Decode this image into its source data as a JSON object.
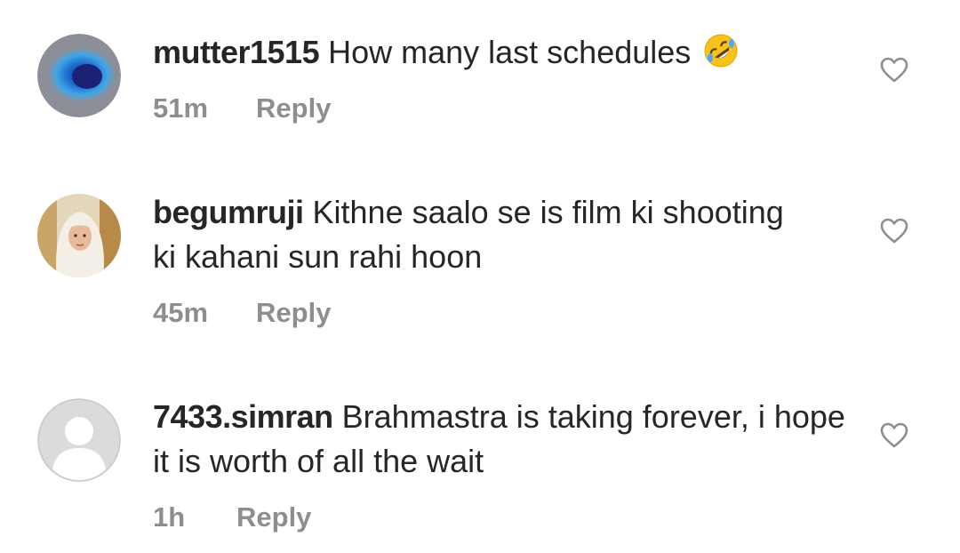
{
  "comments": [
    {
      "username": "mutter1515",
      "text": "How many last schedules",
      "emoji": "rolling-on-floor-laughing-emoji",
      "time": "51m",
      "reply_label": "Reply"
    },
    {
      "username": "begumruji",
      "text": "Kithne saalo se is film ki shooting ki kahani sun rahi hoon",
      "time": "45m",
      "reply_label": "Reply"
    },
    {
      "username": "7433.simran",
      "text": "Brahmastra is taking forever, i hope it is worth of all the wait",
      "time": "1h",
      "reply_label": "Reply"
    }
  ],
  "colors": {
    "text": "#262626",
    "muted": "#8e8e8e",
    "heart_outline": "#8e8e8e"
  }
}
